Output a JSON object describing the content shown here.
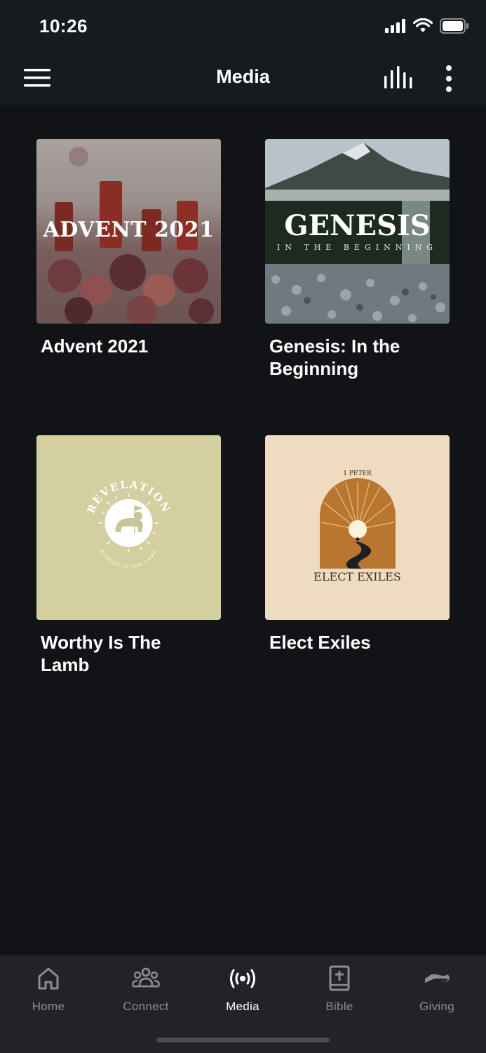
{
  "status_bar": {
    "time": "10:26"
  },
  "header": {
    "title": "Media",
    "menu_icon": "hamburger-icon",
    "queue_icon": "equalizer-icon",
    "more_icon": "vertical-dots-icon"
  },
  "series": [
    {
      "title": "Advent 2021",
      "art_text": "ADVENT 2021"
    },
    {
      "title": "Genesis: In the Beginning",
      "art_text": "GENESIS",
      "art_subtext": "IN THE BEGINNING"
    },
    {
      "title": "Worthy Is The Lamb",
      "art_text": "REVELATION",
      "art_subtext": "WORTHY IS THE LAMB"
    },
    {
      "title": "Elect Exiles",
      "art_text": "ELECT EXILES",
      "art_subtext": "1 PETER"
    }
  ],
  "tabs": [
    {
      "label": "Home",
      "icon": "house-icon"
    },
    {
      "label": "Connect",
      "icon": "people-icon"
    },
    {
      "label": "Media",
      "icon": "broadcast-icon",
      "active": true
    },
    {
      "label": "Bible",
      "icon": "book-cross-icon"
    },
    {
      "label": "Giving",
      "icon": "giving-hand-icon"
    }
  ],
  "colors": {
    "background": "#121316",
    "header": "#161b20",
    "tabbar": "#222327",
    "inactive_tab": "#8b8d92",
    "active_tab": "#ffffff"
  }
}
